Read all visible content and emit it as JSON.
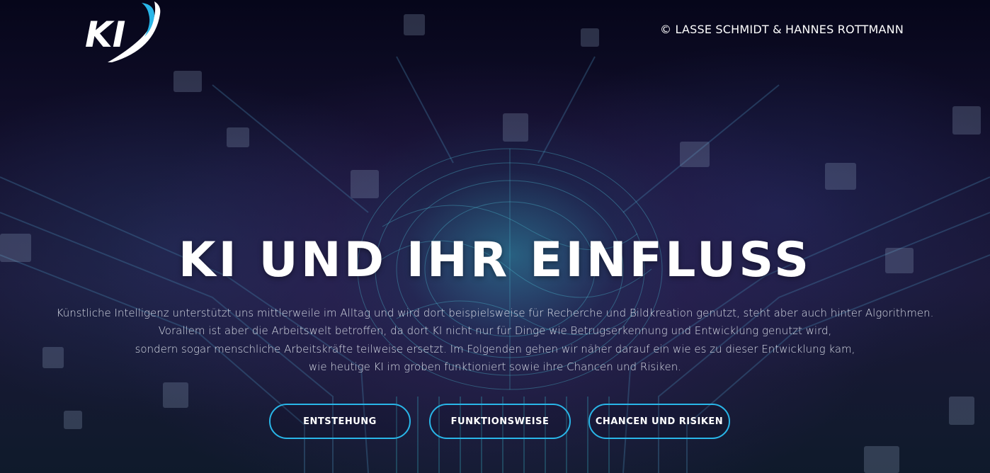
{
  "header": {
    "logo_text": "KI",
    "copyright": "© LASSE SCHMIDT & HANNES ROTTMANN"
  },
  "hero": {
    "title": "KI UND IHR EINFLUSS",
    "intro_lines": [
      "Künstliche Intelligenz unterstützt uns mittlerweile im Alltag und wird dort beispielsweise für Recherche und Bildkreation genutzt, steht aber auch hinter Algorithmen.",
      "Vorallem ist aber die Arbeitswelt betroffen, da dort KI nicht nur für Dinge wie Betrugserkennung und Entwicklung genutzt wird,",
      "sondern sogar menschliche Arbeitskräfte teilweise ersetzt. Im Folgenden gehen wir näher darauf ein wie es zu dieser Entwicklung kam,",
      "wie heutige KI im groben funktioniert sowie ihre Chancen und Risiken."
    ],
    "buttons": [
      {
        "label": "ENTSTEHUNG"
      },
      {
        "label": "FUNKTIONSWEISE"
      },
      {
        "label": "CHANCEN UND RISIKEN"
      }
    ]
  },
  "colors": {
    "accent": "#29b6e8",
    "background": "#0b0a22",
    "text": "#ffffff"
  }
}
